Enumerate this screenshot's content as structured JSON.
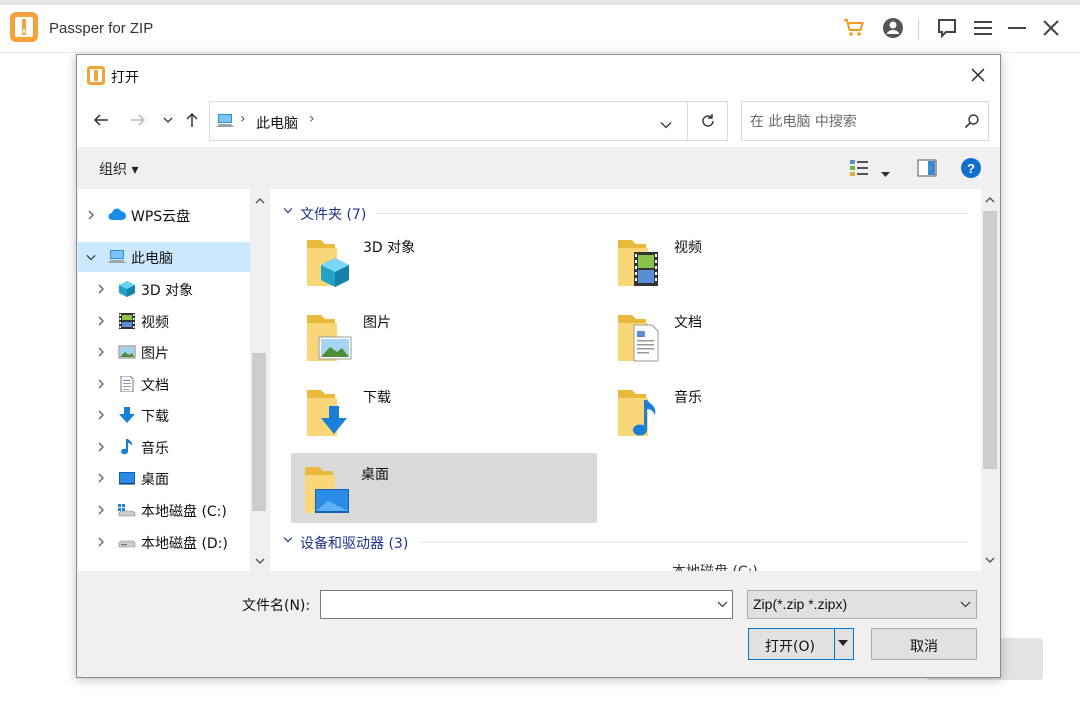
{
  "app": {
    "title": "Passper for ZIP",
    "icons": [
      "cart-icon",
      "account-icon",
      "feedback-icon",
      "menu-icon",
      "minimize-icon",
      "close-icon"
    ],
    "accent_color": "#f4a23a"
  },
  "dialog": {
    "title": "打开",
    "address": {
      "location": "此电脑"
    },
    "search": {
      "placeholder": "在 此电脑 中搜索"
    },
    "toolbar": {
      "organize": "组织 ▾",
      "help": "?"
    },
    "nav_tree": [
      {
        "label": "WPS云盘",
        "icon": "cloud-icon",
        "expanded": false,
        "selected": false,
        "level": 0
      },
      {
        "label": "此电脑",
        "icon": "computer-icon",
        "expanded": true,
        "selected": true,
        "level": 0
      },
      {
        "label": "3D 对象",
        "icon": "cube-icon",
        "expanded": false,
        "selected": false,
        "level": 1
      },
      {
        "label": "视频",
        "icon": "video-icon",
        "expanded": false,
        "selected": false,
        "level": 1
      },
      {
        "label": "图片",
        "icon": "picture-icon",
        "expanded": false,
        "selected": false,
        "level": 1
      },
      {
        "label": "文档",
        "icon": "document-icon",
        "expanded": false,
        "selected": false,
        "level": 1
      },
      {
        "label": "下载",
        "icon": "download-icon",
        "expanded": false,
        "selected": false,
        "level": 1
      },
      {
        "label": "音乐",
        "icon": "music-icon",
        "expanded": false,
        "selected": false,
        "level": 1
      },
      {
        "label": "桌面",
        "icon": "desktop-icon",
        "expanded": false,
        "selected": false,
        "level": 1
      },
      {
        "label": "本地磁盘 (C:)",
        "icon": "drive-c-icon",
        "expanded": false,
        "selected": false,
        "level": 1
      },
      {
        "label": "本地磁盘 (D:)",
        "icon": "drive-d-icon",
        "expanded": false,
        "selected": false,
        "level": 1
      }
    ],
    "groups": {
      "folders_header": "文件夹 (7)",
      "devices_header": "设备和驱动器 (3)"
    },
    "folders": [
      {
        "label": "3D 对象",
        "icon": "folder-3d-objects-icon",
        "selected": false
      },
      {
        "label": "视频",
        "icon": "folder-videos-icon",
        "selected": false
      },
      {
        "label": "图片",
        "icon": "folder-pictures-icon",
        "selected": false
      },
      {
        "label": "文档",
        "icon": "folder-documents-icon",
        "selected": false
      },
      {
        "label": "下载",
        "icon": "folder-downloads-icon",
        "selected": false
      },
      {
        "label": "音乐",
        "icon": "folder-music-icon",
        "selected": false
      },
      {
        "label": "桌面",
        "icon": "folder-desktop-icon",
        "selected": true
      }
    ],
    "devices_partial_label": "本地磁盘 (C:)",
    "filename": {
      "label": "文件名(N):",
      "value": ""
    },
    "filetype": {
      "selected": "Zip(*.zip *.zipx)"
    },
    "buttons": {
      "open": "打开(O)",
      "cancel": "取消"
    },
    "colors": {
      "selection": "#cce8ff",
      "group_header": "#1e3287",
      "primary_border": "#0078d7",
      "help": "#1170cf"
    }
  }
}
